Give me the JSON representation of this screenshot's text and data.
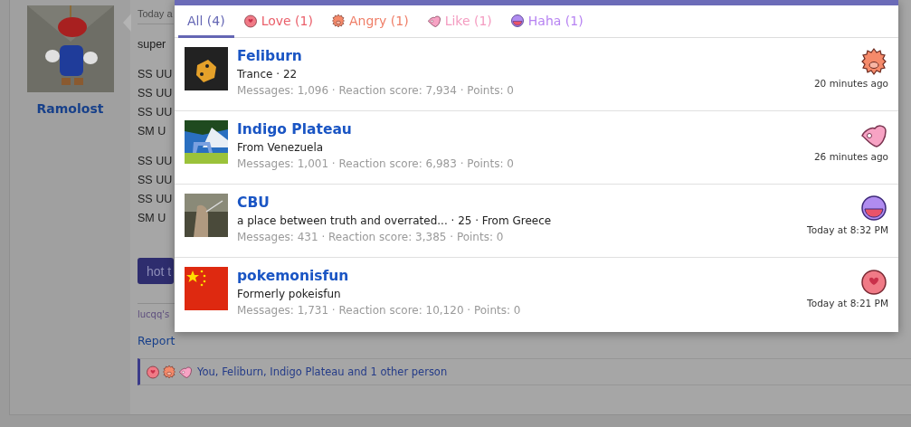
{
  "post": {
    "author": "Ramolost",
    "date": "Today a",
    "paragraphs": [
      [
        "super"
      ],
      [
        "SS UU",
        "SS UU",
        "SS UU",
        "SM U"
      ],
      [
        "SS UU",
        "SS UU",
        "SS UU",
        "SM U"
      ]
    ],
    "button": "hot t",
    "signature": "lucqq's",
    "report": "Report",
    "reactions_bar": {
      "reactions": [
        {
          "kind": "love"
        },
        {
          "kind": "angry"
        },
        {
          "kind": "like"
        }
      ],
      "text": "You, Feliburn, Indigo Plateau and 1 other person"
    }
  },
  "dialog": {
    "tabs": [
      {
        "label": "All (4)",
        "kind": "all",
        "selected": true,
        "color": "#6466b4"
      },
      {
        "label": "Love (1)",
        "kind": "love",
        "selected": false,
        "color": "#ea5f6a"
      },
      {
        "label": "Angry (1)",
        "kind": "angry",
        "selected": false,
        "color": "#ef7e67"
      },
      {
        "label": "Like (1)",
        "kind": "like",
        "selected": false,
        "color": "#f49bc0"
      },
      {
        "label": "Haha (1)",
        "kind": "haha",
        "selected": false,
        "color": "#b783f2"
      }
    ],
    "rows": [
      {
        "name": "Feliburn",
        "subtitle": "Trance · 22",
        "stats": "Messages: 1,096 · Reaction score: 7,934 · Points: 0",
        "kind": "angry",
        "time": "20 minutes ago"
      },
      {
        "name": "Indigo Plateau",
        "subtitle": "From Venezuela",
        "stats": "Messages: 1,001 · Reaction score: 6,983 · Points: 0",
        "kind": "like",
        "time": "26 minutes ago"
      },
      {
        "name": "CBU",
        "subtitle": "a place between truth and overrated... · 25 · From Greece",
        "stats": "Messages: 431 · Reaction score: 3,385 · Points: 0",
        "kind": "haha",
        "time": "Today at 8:32 PM"
      },
      {
        "name": "pokemonisfun",
        "subtitle": "Formerly pokeisfun",
        "stats": "Messages: 1,731 · Reaction score: 10,120 · Points: 0",
        "kind": "love",
        "time": "Today at 8:21 PM"
      }
    ]
  }
}
